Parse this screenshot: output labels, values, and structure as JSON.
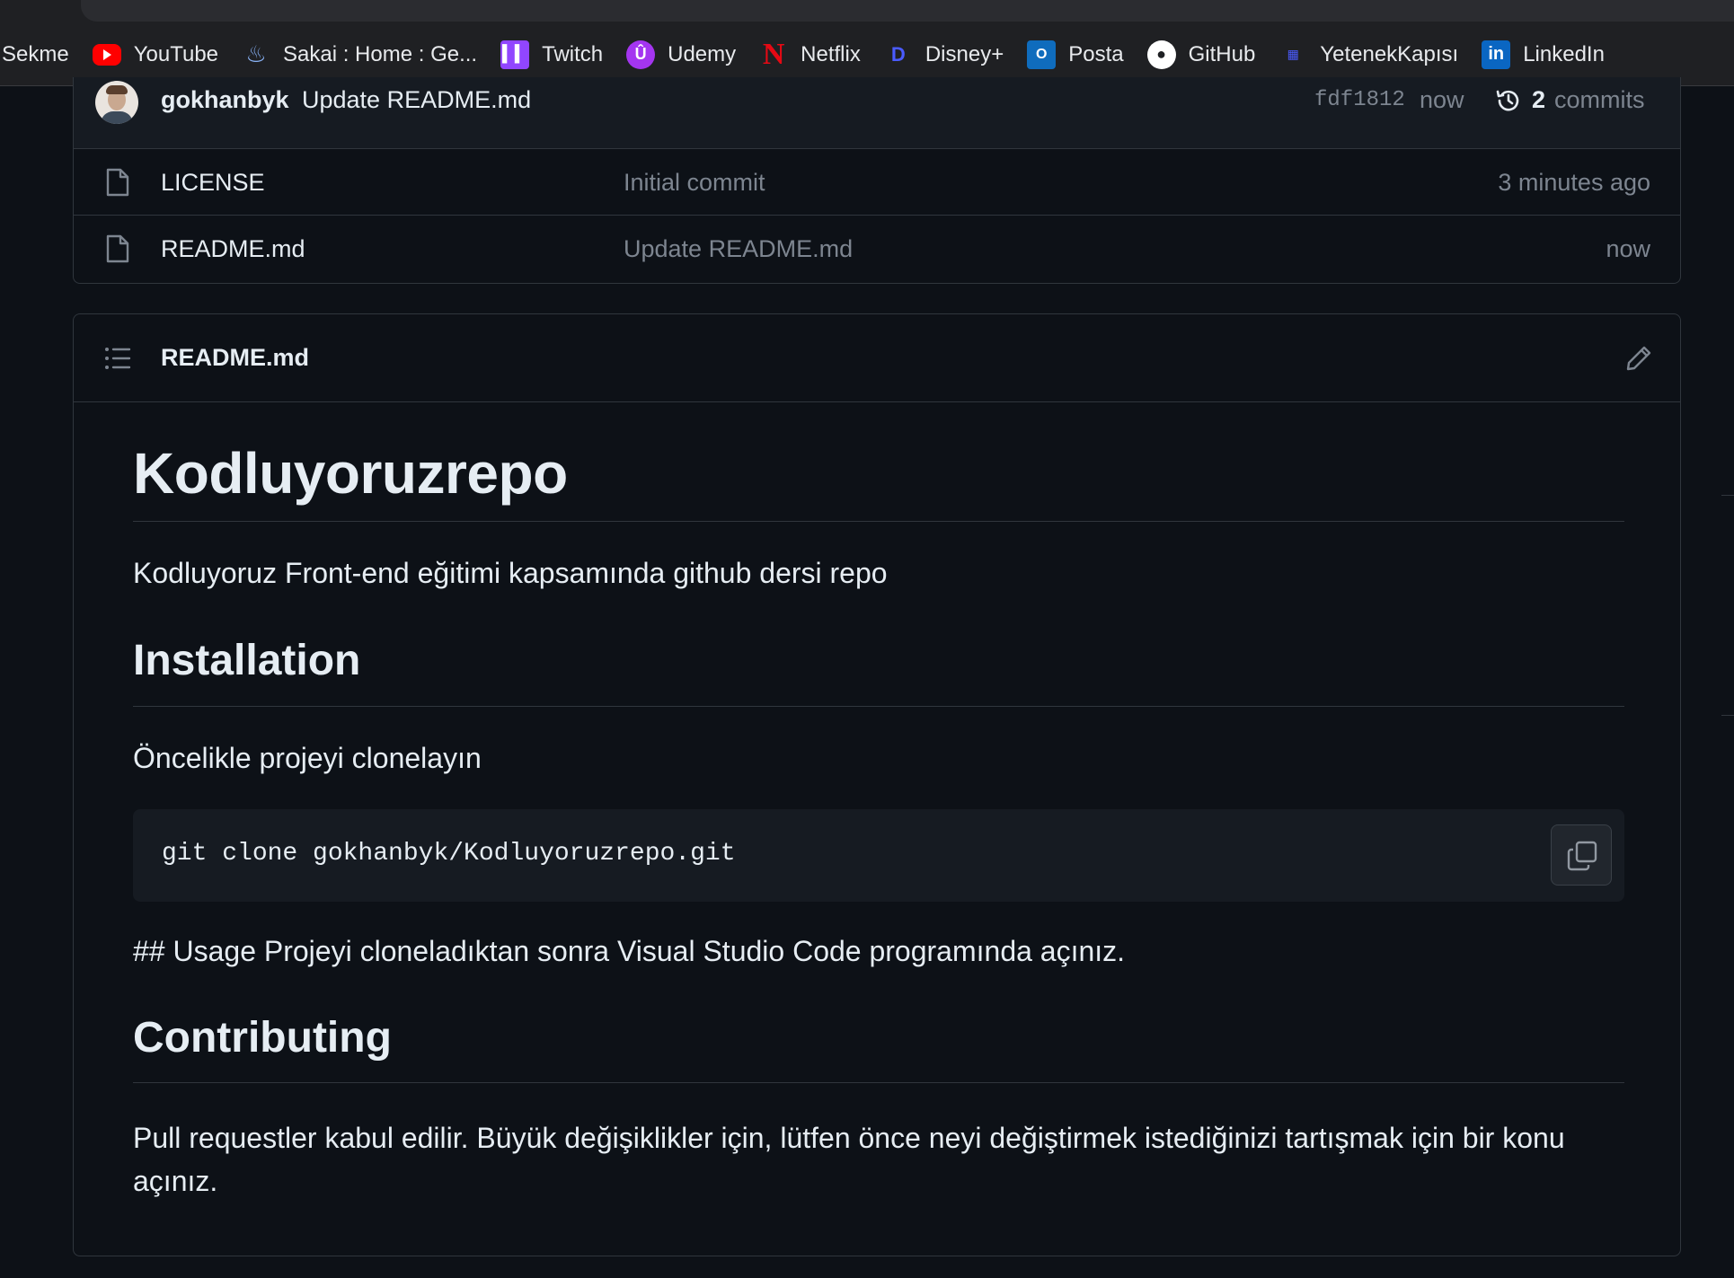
{
  "bookmarks": [
    {
      "label": "Sekme",
      "icon": "none"
    },
    {
      "label": "YouTube",
      "icon": "youtube-icon"
    },
    {
      "label": "Sakai : Home : Ge...",
      "icon": "sakai-icon"
    },
    {
      "label": "Twitch",
      "icon": "twitch-icon"
    },
    {
      "label": "Udemy",
      "icon": "udemy-icon"
    },
    {
      "label": "Netflix",
      "icon": "netflix-icon"
    },
    {
      "label": "Disney+",
      "icon": "disney-icon"
    },
    {
      "label": "Posta",
      "icon": "outlook-icon"
    },
    {
      "label": "GitHub",
      "icon": "github-icon"
    },
    {
      "label": "YetenekKapısı",
      "icon": "yetenekkapisi-icon"
    },
    {
      "label": "LinkedIn",
      "icon": "linkedin-icon"
    }
  ],
  "latest_commit": {
    "user": "gokhanbyk",
    "message": "Update README.md",
    "sha": "fdf1812",
    "time": "now",
    "commits_count": "2",
    "commits_label": "commits"
  },
  "files": [
    {
      "name": "LICENSE",
      "commit": "Initial commit",
      "time": "3 minutes ago"
    },
    {
      "name": "README.md",
      "commit": "Update README.md",
      "time": "now"
    }
  ],
  "readme": {
    "filename": "README.md",
    "title": "Kodluyoruzrepo",
    "intro": "Kodluyoruz Front-end eğitimi kapsamında github dersi repo",
    "installation_heading": "Installation",
    "installation_text": "Öncelikle projeyi clonelayın",
    "code": "git clone gokhanbyk/Kodluyoruzrepo.git",
    "usage_text": "## Usage Projeyi cloneladıktan sonra Visual Studio Code programında açınız.",
    "contributing_heading": "Contributing",
    "contributing_text": "Pull requestler kabul edilir. Büyük değişiklikler için, lütfen önce neyi değiştirmek istediğinizi tartışmak için bir konu açınız."
  },
  "colors": {
    "background": "#0d1117",
    "border": "#30363d",
    "muted": "#7d8590",
    "text": "#e6edf3",
    "link": "#4493f8"
  }
}
